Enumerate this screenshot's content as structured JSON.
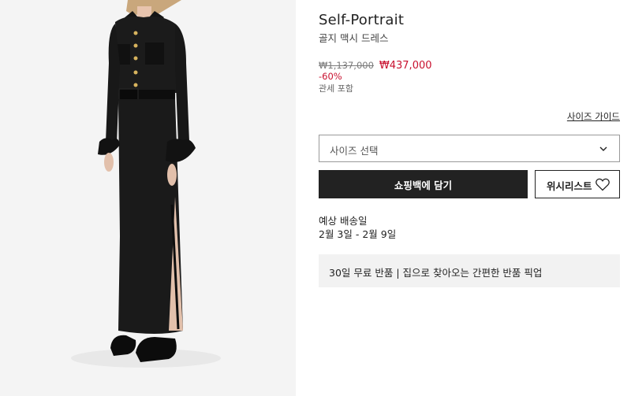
{
  "product": {
    "brand": "Self-Portrait",
    "name": "골지 맥시 드레스",
    "price_original": "₩1,137,000",
    "price_sale": "₩437,000",
    "discount": "-60%",
    "tax_note": "관세 포함"
  },
  "size": {
    "guide_label": "사이즈 가이드",
    "select_label": "사이즈 선택"
  },
  "actions": {
    "add_to_bag_label": "쇼핑백에 담기",
    "wishlist_label": "위시리스트"
  },
  "delivery": {
    "title": "예상 배송일",
    "dates": "2월 3일 - 2월 9일"
  },
  "returns": {
    "text": "30일 무료 반품 | 집으로 찾아오는 간편한 반품 픽업"
  },
  "colors": {
    "sale": "#c8102e",
    "button_dark": "#222222",
    "image_bg": "#f4f4f4"
  }
}
